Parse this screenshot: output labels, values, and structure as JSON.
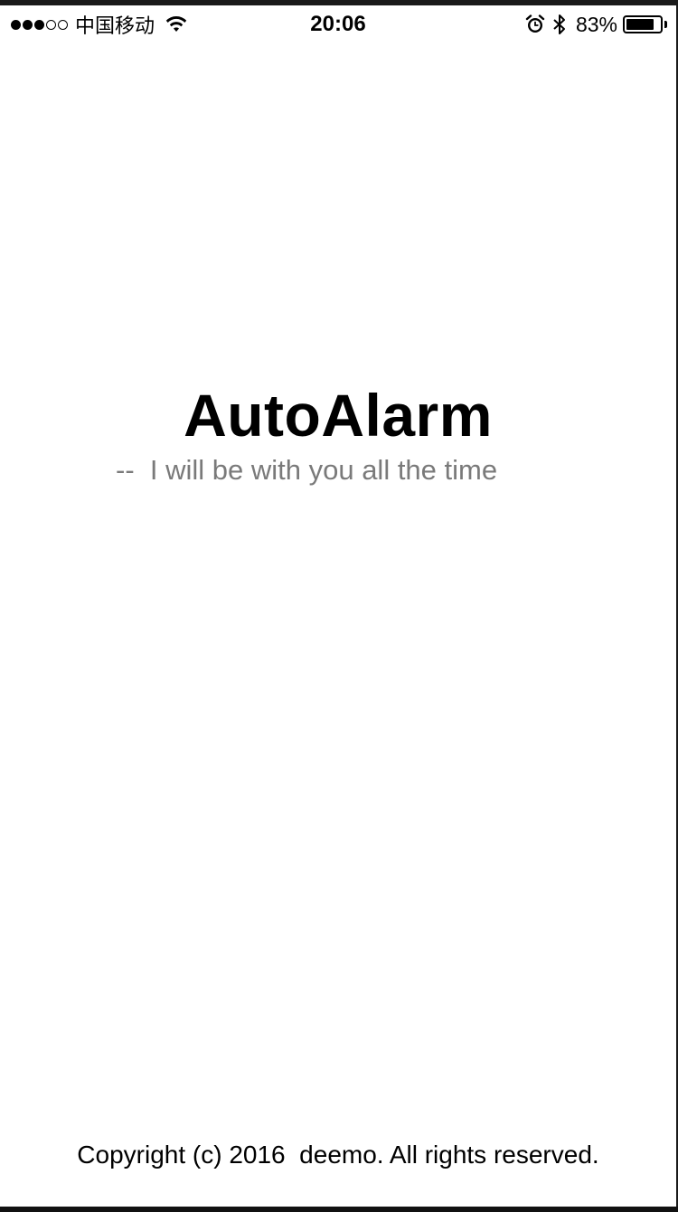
{
  "status_bar": {
    "carrier": "中国移动",
    "time": "20:06",
    "battery_percent_label": "83%",
    "battery_level": 0.83,
    "signal_bars_filled": 3,
    "signal_bars_total": 5,
    "icons": [
      "wifi-icon",
      "alarm-clock-icon",
      "bluetooth-icon",
      "battery-icon"
    ]
  },
  "splash": {
    "title": "AutoAlarm",
    "tagline": "--  I will be with you all the time"
  },
  "footer": {
    "copyright": "Copyright (c) 2016  deemo. All rights reserved."
  },
  "colors": {
    "background": "#ffffff",
    "title": "#000000",
    "tagline": "#7a7a7a"
  }
}
